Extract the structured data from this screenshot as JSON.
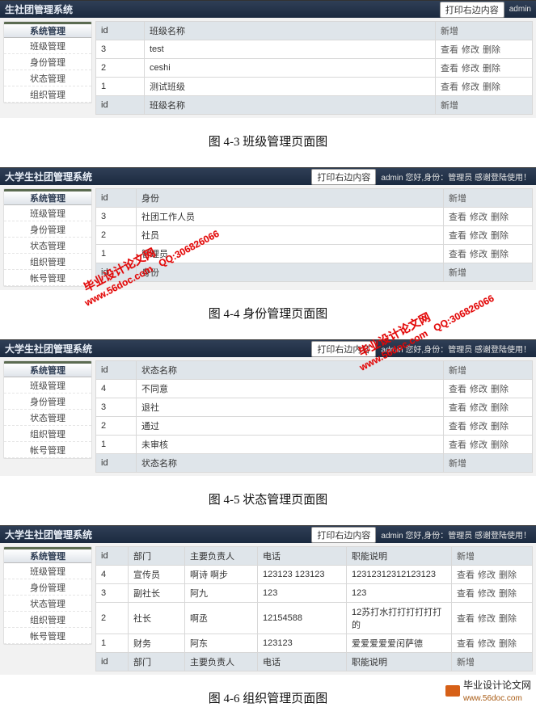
{
  "sidebar": {
    "head": "系统管理",
    "items": [
      "班级管理",
      "身份管理",
      "状态管理",
      "组织管理",
      "帐号管理"
    ]
  },
  "topbar": {
    "short_title": "生社团管理系统",
    "full_title": "大学生社团管理系统",
    "print_btn": "打印右边内容",
    "user_info": "admin 您好,身份：管理员 感谢登陆使用！",
    "admin_label": "admin"
  },
  "labels": {
    "view": "查看",
    "edit": "修改",
    "delete": "删除",
    "add": "新增"
  },
  "captions": {
    "c1": "图 4-3 班级管理页面图",
    "c2": "图 4-4 身份管理页面图",
    "c3": "图 4-5 状态管理页面图",
    "c4": "图 4-6 组织管理页面图"
  },
  "tables": {
    "t1": {
      "cols": [
        "id",
        "班级名称"
      ],
      "rows": [
        [
          "3",
          "test"
        ],
        [
          "2",
          "ceshi"
        ],
        [
          "1",
          "测试班级"
        ]
      ]
    },
    "t2": {
      "cols": [
        "id",
        "身份"
      ],
      "rows": [
        [
          "3",
          "社团工作人员"
        ],
        [
          "2",
          "社员"
        ],
        [
          "1",
          "管理员"
        ]
      ]
    },
    "t3": {
      "cols": [
        "id",
        "状态名称"
      ],
      "rows": [
        [
          "4",
          "不同意"
        ],
        [
          "3",
          "退社"
        ],
        [
          "2",
          "通过"
        ],
        [
          "1",
          "未审核"
        ]
      ]
    },
    "t4": {
      "cols": [
        "id",
        "部门",
        "主要负责人",
        "电话",
        "职能说明"
      ],
      "rows": [
        [
          "4",
          "宣传员",
          "啊诗 啊步",
          "123123 123123",
          "12312312312123123"
        ],
        [
          "3",
          "副社长",
          "阿九",
          "123",
          "123"
        ],
        [
          "2",
          "社长",
          "啊丞",
          "12154588",
          "12苏打水打打打打打打的"
        ],
        [
          "1",
          "财务",
          "阿东",
          "123123",
          "爱爱爱爱爱闰萨德"
        ]
      ]
    }
  },
  "watermark": {
    "l1": "毕业设计论文网",
    "l2": "www.56doc.com   QQ:306826066"
  },
  "footer": {
    "t1": "毕业设计论文网",
    "t2": "www.56doc.com"
  }
}
